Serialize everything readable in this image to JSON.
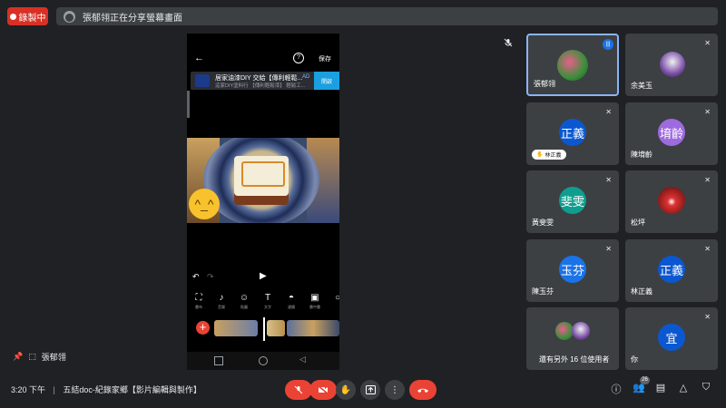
{
  "recording": {
    "label": "錄製中"
  },
  "banner": {
    "text": "張郁翎正在分享螢幕畫面"
  },
  "shared": {
    "back_icon": "arrow-left-icon",
    "save_label": "保存",
    "ad": {
      "title": "居家油漆DIY 交給【傳利輕鬆...",
      "subtitle": "這家DIY塗料行 【傳利輕鬆漆】 輕鬆工...",
      "tag": "AD",
      "button": "開啟"
    },
    "tools": [
      {
        "icon": "crop-icon",
        "label": "畫布"
      },
      {
        "icon": "music-icon",
        "label": "音樂"
      },
      {
        "icon": "sticker-icon",
        "label": "貼圖"
      },
      {
        "icon": "text-icon",
        "label": "文字"
      },
      {
        "icon": "effect-icon",
        "label": "濾鏡"
      },
      {
        "icon": "frame-icon",
        "label": "畫中畫"
      },
      {
        "icon": "more-icon",
        "label": ""
      }
    ]
  },
  "presenter_name": "張郁翎",
  "tiles": [
    {
      "name": "張郁翎",
      "avatar_text": "",
      "color": "#8ab4f8",
      "active": true
    },
    {
      "name": "余美玉",
      "avatar_text": "",
      "color": ""
    },
    {
      "name": "",
      "avatar_text": "正義",
      "color": "#0b57d0",
      "chip": "林正義"
    },
    {
      "name": "陳堉齡",
      "avatar_text": "堉齡",
      "color": "#9e6adf"
    },
    {
      "name": "黃斐雯",
      "avatar_text": "斐雯",
      "color": "#0f9d8f"
    },
    {
      "name": "松坪",
      "avatar_text": "",
      "color": ""
    },
    {
      "name": "陳玉芬",
      "avatar_text": "玉芬",
      "color": "#1a73e8"
    },
    {
      "name": "林正義",
      "avatar_text": "正義",
      "color": "#0b57d0"
    },
    {
      "name": "還有另外 16 位使用者",
      "avatar_text": "",
      "color": ""
    },
    {
      "name": "你",
      "avatar_text": "宜",
      "color": "#0b57d0"
    }
  ],
  "bottom": {
    "time": "3:20 下午",
    "separator": "|",
    "meeting_title": "五結doc-紀錄家鄉【影片編輯與製作】",
    "people_count": "26"
  }
}
